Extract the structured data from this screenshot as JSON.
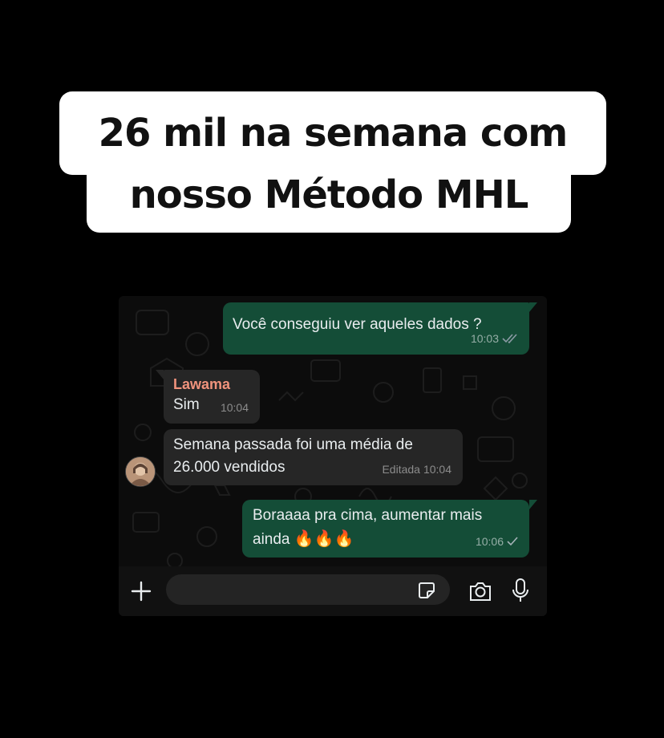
{
  "caption": {
    "line1": "26 mil na semana com",
    "line2": "nosso Método MHL"
  },
  "chat": {
    "messages": [
      {
        "direction": "outgoing",
        "text": "Você conseguiu ver aqueles dados ?",
        "time": "10:03",
        "status": "read"
      },
      {
        "direction": "incoming",
        "sender": "Lawama",
        "text": "Sim",
        "time": "10:04"
      },
      {
        "direction": "incoming",
        "text_line1": "Semana passada foi uma média de",
        "text_line2": "26.000 vendidos",
        "edited_label": "Editada",
        "time": "10:04"
      },
      {
        "direction": "outgoing",
        "text_line1": "Boraaaa pra cima, aumentar mais",
        "text_line2": "ainda",
        "emojis": "🔥🔥🔥",
        "time": "10:06",
        "status": "sent"
      }
    ],
    "composer": {
      "input_value": "",
      "icons": [
        "plus-icon",
        "sticker-icon",
        "camera-icon",
        "microphone-icon"
      ]
    }
  },
  "colors": {
    "background": "#000000",
    "outgoing_bubble": "#144d37",
    "incoming_bubble": "#262626",
    "sender_name": "#f0937c",
    "read_tick": "#8a9aa4"
  }
}
